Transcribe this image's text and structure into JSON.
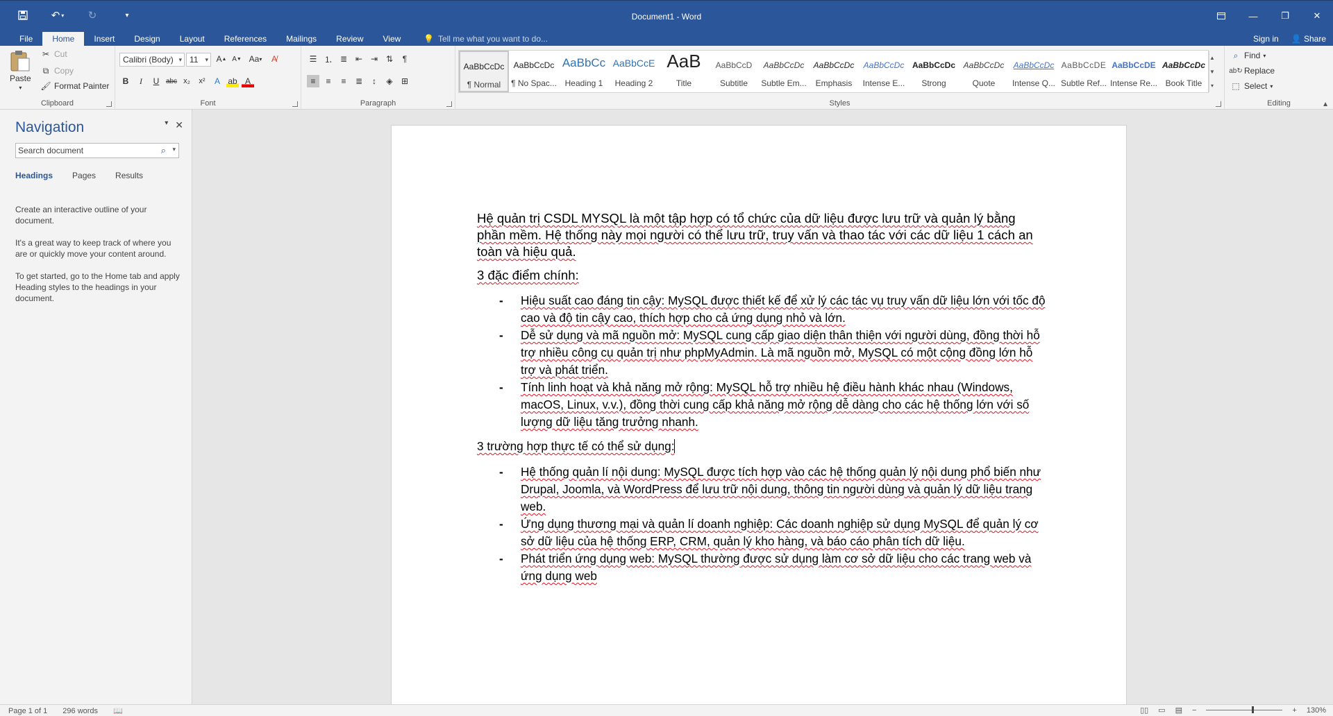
{
  "app": {
    "title": "Document1 - Word"
  },
  "quick_access": {
    "save_icon": "save-icon",
    "undo_icon": "undo-icon",
    "redo_icon": "redo-icon",
    "customize_icon": "customize-icon"
  },
  "menu": {
    "tabs": [
      "File",
      "Home",
      "Insert",
      "Design",
      "Layout",
      "References",
      "Mailings",
      "Review",
      "View"
    ],
    "active_tab": "Home",
    "tell_me": "Tell me what you want to do...",
    "sign_in": "Sign in",
    "share": "Share"
  },
  "clipboard": {
    "paste": "Paste",
    "cut": "Cut",
    "copy": "Copy",
    "format_painter": "Format Painter",
    "label": "Clipboard"
  },
  "font": {
    "name": "Calibri (Body)",
    "size": "11",
    "change_case": "Aa",
    "label": "Font"
  },
  "paragraph": {
    "label": "Paragraph"
  },
  "styles": {
    "label": "Styles",
    "items": [
      {
        "sample": "AaBbCcDc",
        "name": "¶ Normal"
      },
      {
        "sample": "AaBbCcDc",
        "name": "¶ No Spac..."
      },
      {
        "sample": "AaBbCc",
        "name": "Heading 1"
      },
      {
        "sample": "AaBbCcE",
        "name": "Heading 2"
      },
      {
        "sample": "AaB",
        "name": "Title"
      },
      {
        "sample": "AaBbCcD",
        "name": "Subtitle"
      },
      {
        "sample": "AaBbCcDc",
        "name": "Subtle Em..."
      },
      {
        "sample": "AaBbCcDc",
        "name": "Emphasis"
      },
      {
        "sample": "AaBbCcDc",
        "name": "Intense E..."
      },
      {
        "sample": "AaBbCcDc",
        "name": "Strong"
      },
      {
        "sample": "AaBbCcDc",
        "name": "Quote"
      },
      {
        "sample": "AaBbCcDc",
        "name": "Intense Q..."
      },
      {
        "sample": "AaBbCcDE",
        "name": "Subtle Ref..."
      },
      {
        "sample": "AaBbCcDE",
        "name": "Intense Re..."
      },
      {
        "sample": "AaBbCcDc",
        "name": "Book Title"
      }
    ]
  },
  "editing": {
    "find": "Find",
    "replace": "Replace",
    "select": "Select",
    "label": "Editing"
  },
  "navigation": {
    "title": "Navigation",
    "search_placeholder": "Search document",
    "tabs": [
      "Headings",
      "Pages",
      "Results"
    ],
    "help": [
      "Create an interactive outline of your document.",
      "It's a great way to keep track of where you are or quickly move your content around.",
      "To get started, go to the Home tab and apply Heading styles to the headings in your document."
    ]
  },
  "document": {
    "intro": "Hệ quản trị CSDL MYSQL là một tập hợp có tổ chức của dữ liệu được lưu trữ và quản lý bằng phần mềm. Hệ thống này mọi người có thể lưu trữ, truy vấn và thao tác với các dữ liệu 1 cách an toàn và hiệu quả.",
    "heading1": "3 đặc điểm chính:",
    "features": [
      "Hiệu suất cao đáng tin cậy: MySQL được thiết kế để xử lý các tác vụ truy vấn dữ liệu lớn với tốc độ cao và độ tin cậy cao, thích hợp cho cả ứng dụng nhỏ và lớn.",
      "Dễ sử dụng và mã nguồn mở: MySQL cung cấp giao diện thân thiện với người dùng, đồng thời hỗ trợ nhiều công cụ quản trị như phpMyAdmin. Là mã nguồn mở, MySQL có một cộng đồng lớn hỗ trợ và phát triển.",
      "Tính linh hoạt và khả năng mở rộng: MySQL hỗ trợ nhiều hệ điều hành khác nhau (Windows, macOS, Linux, v.v.), đồng thời cung cấp khả năng mở rộng dễ dàng cho các hệ thống lớn với số lượng dữ liệu tăng trưởng nhanh."
    ],
    "heading2": "3 trường hợp thực tế có thể sử dụng:",
    "usecases": [
      "Hệ thống quản lí nội dung: MySQL được tích hợp vào các hệ thống quản lý nội dung phổ biến như Drupal, Joomla, và WordPress để lưu trữ nội dung, thông tin người dùng và quản lý dữ liệu trang web.",
      "Ứng dụng thương mại và quản lí doanh nghiệp: Các doanh nghiệp sử dụng MySQL để quản lý cơ sở dữ liệu của hệ thống ERP, CRM, quản lý kho hàng, và báo cáo phân tích dữ liệu.",
      "Phát triển ứng dụng web: MySQL thường được sử dụng làm cơ sở dữ liệu cho các trang web và ứng dụng web"
    ]
  },
  "status": {
    "page": "Page 1 of 1",
    "words": "296 words",
    "zoom": "130%"
  },
  "colors": {
    "accent": "#2b579a",
    "spell_underline": "#e81123"
  }
}
